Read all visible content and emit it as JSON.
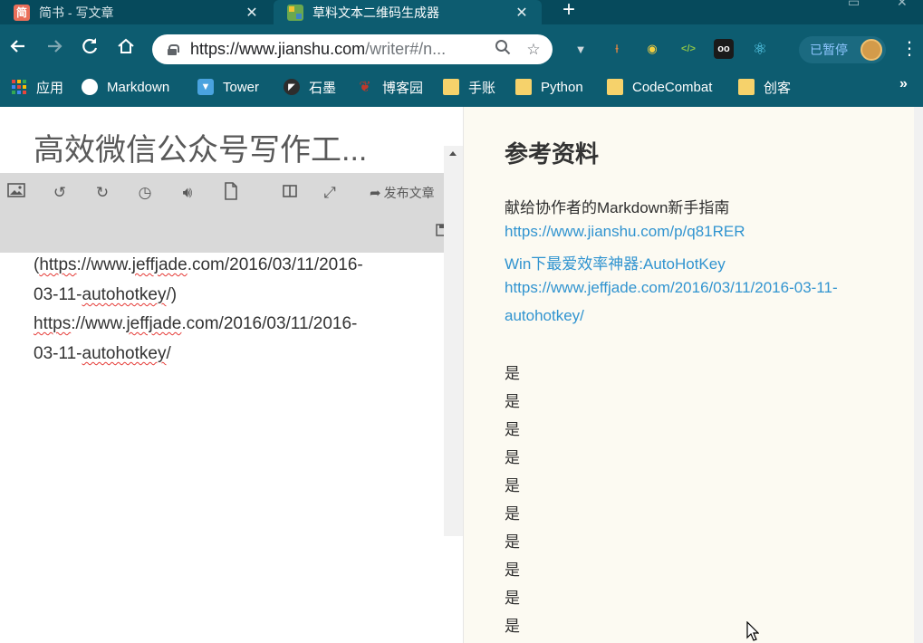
{
  "tabs": [
    {
      "favicon": "jianshu-icon",
      "favicon_char": "简",
      "title": "简书 - 写文章",
      "active": false
    },
    {
      "favicon": "qr-generator-icon",
      "title": "草料文本二维码生成器",
      "active": true
    }
  ],
  "address_bar": {
    "url_main": "https://www.jianshu.com",
    "url_rest": "/writer#/n..."
  },
  "profile": {
    "label": "已暂停"
  },
  "bookmarks": [
    {
      "label": "应用",
      "icon": "apps-grid-icon"
    },
    {
      "label": "Markdown",
      "icon": "markdown-icon"
    },
    {
      "label": "Tower",
      "icon": "tower-icon"
    },
    {
      "label": "石墨",
      "icon": "shimo-icon"
    },
    {
      "label": "博客园",
      "icon": "cnblogs-icon"
    },
    {
      "label": "手账",
      "icon": "folder-icon"
    },
    {
      "label": "Python",
      "icon": "folder-icon"
    },
    {
      "label": "CodeCombat",
      "icon": "folder-icon"
    },
    {
      "label": "创客",
      "icon": "folder-icon"
    }
  ],
  "editor": {
    "title": "高效微信公众号写作工...",
    "publish_label": "发布文章",
    "lines": [
      {
        "pre": "(",
        "sq1": "https",
        "mid": "://www.",
        "sq2": "jeffjade",
        "post": ".com/2016/03/11/2016-"
      },
      {
        "pre": "03-11-",
        "sq1": "autohotkey",
        "mid": "/)",
        "sq2": "",
        "post": ""
      },
      {
        "pre": "",
        "sq1": "https",
        "mid": "://www.",
        "sq2": "jeffjade",
        "post": ".com/2016/03/11/2016-"
      },
      {
        "pre": "03-11-",
        "sq1": "autohotkey",
        "mid": "/",
        "sq2": "",
        "post": ""
      }
    ]
  },
  "preview": {
    "heading": "参考资料",
    "lines": [
      {
        "text": "献给协作者的Markdown新手指南",
        "kind": "txt"
      },
      {
        "text": "https://www.jianshu.com/p/q81RER",
        "kind": "link"
      },
      {
        "text": "Win下最爱效率神器:AutoHotKey",
        "kind": "link"
      },
      {
        "text": "https://www.jeffjade.com/2016/03/11/2016-03-11-",
        "kind": "link"
      },
      {
        "text": "autohotkey/",
        "kind": "link"
      }
    ],
    "repeat_lines": [
      "是",
      "是",
      "是",
      "是",
      "是",
      "是",
      "是",
      "是",
      "是",
      "是"
    ]
  }
}
